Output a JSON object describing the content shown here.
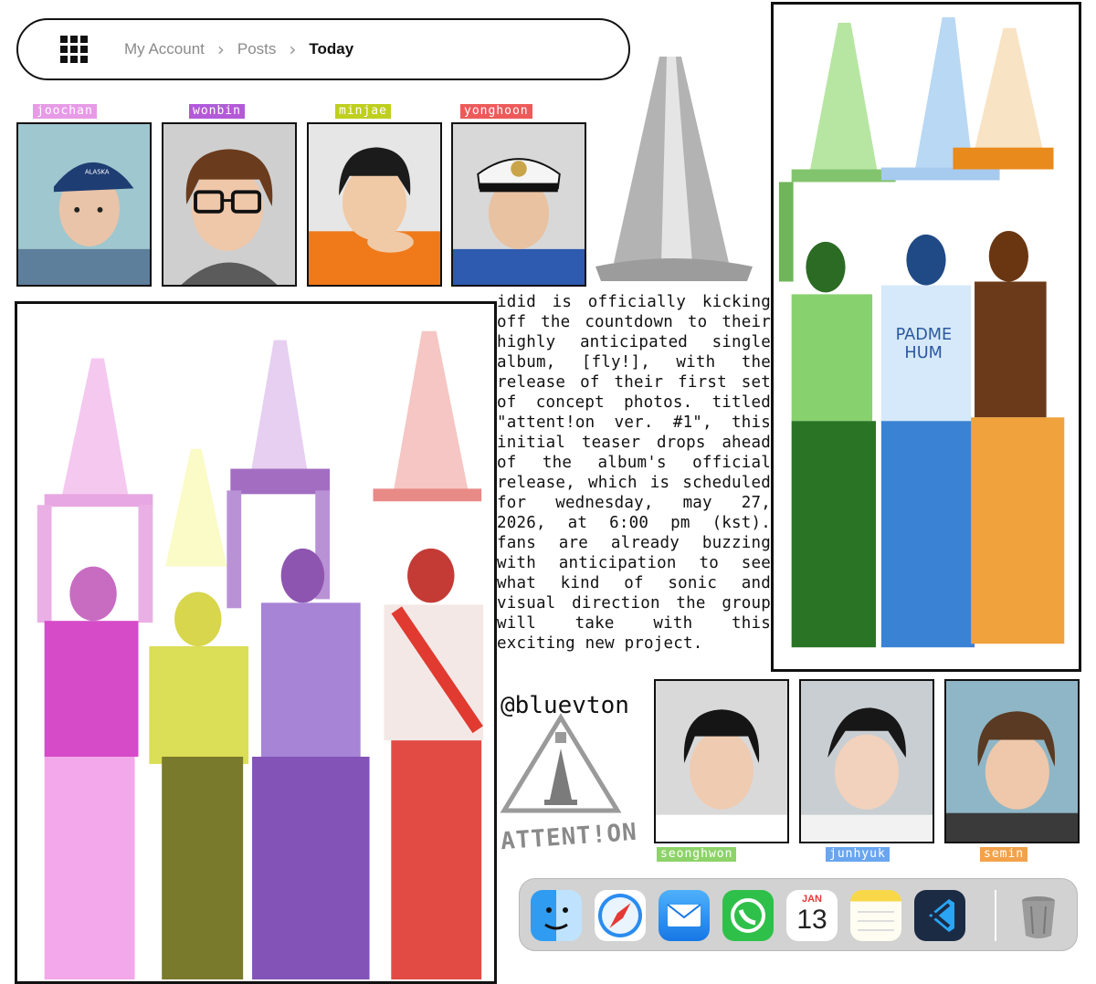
{
  "breadcrumb": {
    "items": [
      "My Account",
      "Posts",
      "Today"
    ]
  },
  "top_members": [
    {
      "name": "joochan",
      "color": "#e79be6"
    },
    {
      "name": "wonbin",
      "color": "#b25ad8"
    },
    {
      "name": "minjae",
      "color": "#bfcf1e"
    },
    {
      "name": "yonghoon",
      "color": "#ee5a5a"
    }
  ],
  "bottom_members": [
    {
      "name": "seonghwon",
      "color": "#8ed36a"
    },
    {
      "name": "junhyuk",
      "color": "#6aa6f0"
    },
    {
      "name": "semin",
      "color": "#f3a24a"
    }
  ],
  "article": {
    "text": "idid is officially kicking off the countdown to their highly anticipated single album, [fly!], with the release of their first set of concept photos. titled \"attent!on ver. #1\", this initial teaser drops ahead of the album's official release, which is scheduled for wednesday, may 27, 2026, at 6:00 pm (kst). fans are already buzzing with anticipation to see what kind of sonic and visual direction the group will take with this exciting new project.",
    "handle": "@bluevton"
  },
  "attention_sign": "ATTENT!ON",
  "dock": {
    "calendar_month": "JAN",
    "calendar_day": "13",
    "apps": [
      "finder-icon",
      "safari-icon",
      "mail-icon",
      "whatsapp-icon",
      "calendar-icon",
      "notes-icon",
      "vscode-icon",
      "trash-icon"
    ]
  }
}
